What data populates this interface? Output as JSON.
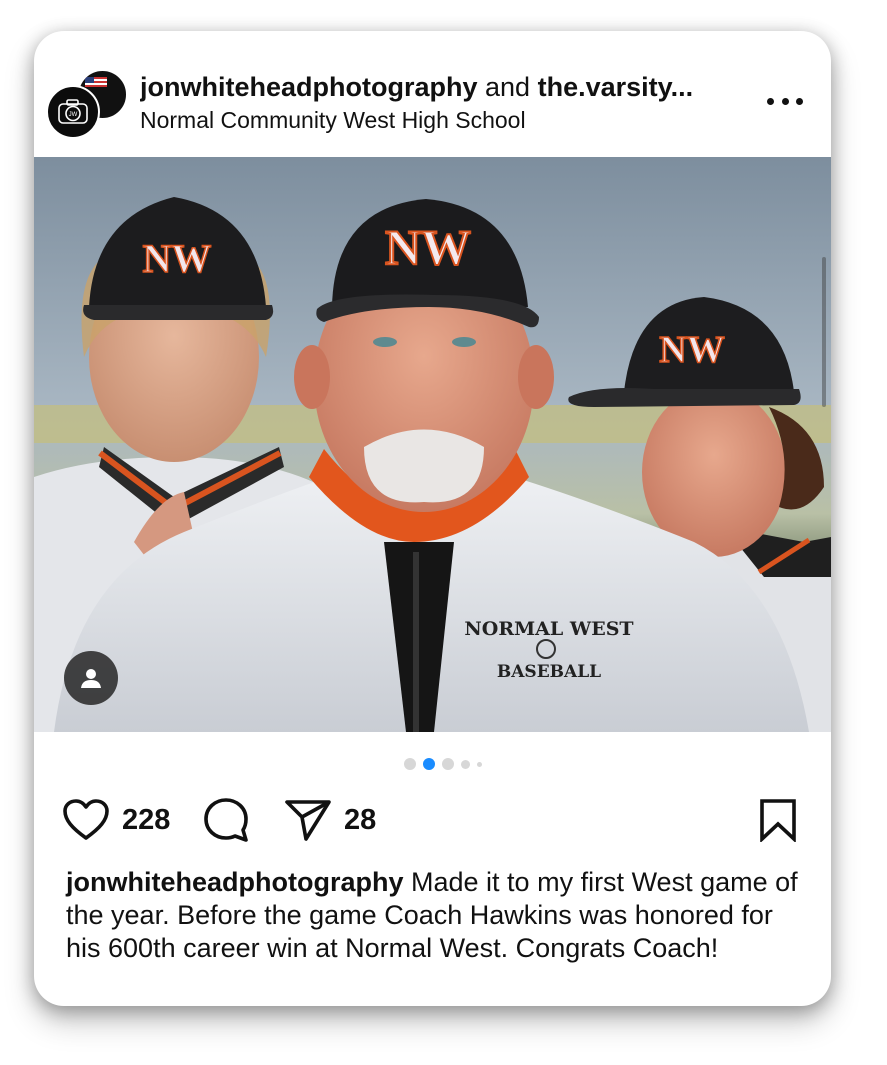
{
  "post": {
    "author": "jonwhiteheadphotography",
    "joiner": "and",
    "coauthor": "the.varsity...",
    "location": "Normal Community West High School",
    "author_avatar_icon": "camera-logo-icon",
    "coauthor_avatar_icon": "flag-logo-icon",
    "more_icon": "more-options-icon"
  },
  "photo": {
    "jacket_text_line1": "NORMAL WEST",
    "jacket_text_line2": "BASEBALL",
    "cap_logo": "NW",
    "user_tag_icon": "person-icon"
  },
  "carousel": {
    "count": 5,
    "active_index": 1,
    "active_color": "#1a8cff",
    "inactive_color": "#d7d7d7"
  },
  "actions": {
    "likes": "228",
    "shares": "28",
    "like_icon": "heart-icon",
    "comment_icon": "comment-icon",
    "share_icon": "share-icon",
    "save_icon": "bookmark-icon"
  },
  "caption": {
    "author": "jonwhiteheadphotography",
    "text": "Made it to my first West game of the year.  Before the game Coach Hawkins was honored for his 600th career win at Normal West. Congrats Coach!"
  }
}
